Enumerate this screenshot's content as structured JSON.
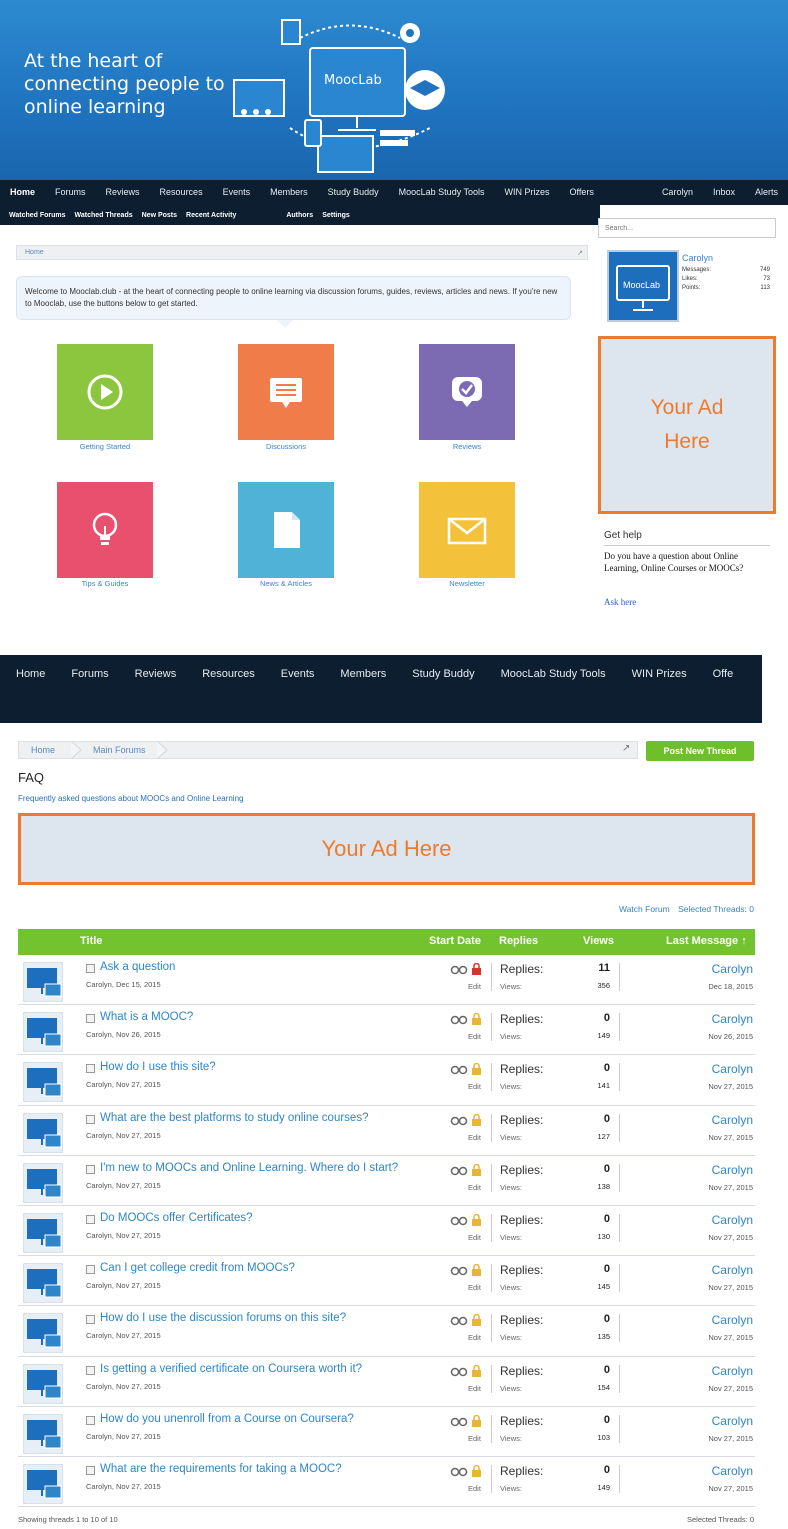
{
  "top": {
    "hero": {
      "tagline": "At the heart of connecting people to online learning",
      "logo_text": "MoocLab"
    },
    "nav": {
      "items": [
        "Home",
        "Forums",
        "Reviews",
        "Resources",
        "Events",
        "Members",
        "Study Buddy",
        "MoocLab Study Tools",
        "WIN Prizes",
        "Offers"
      ],
      "right_items": [
        "Carolyn",
        "Inbox",
        "Alerts"
      ]
    },
    "subnav": {
      "items": [
        "Watched Forums",
        "Watched Threads",
        "New Posts",
        "Recent Activity"
      ],
      "right_items": [
        "Authors",
        "Settings"
      ]
    },
    "breadcrumb": {
      "home": "Home"
    },
    "welcome_text": "Welcome to Mooclab.club - at the heart of connecting people to online learning via discussion forums, guides, reviews, articles and news. If you're new to Mooclab, use the buttons below to get started.",
    "tiles": [
      {
        "label": "Getting Started",
        "color": "#8cc63f",
        "icon": "play-icon"
      },
      {
        "label": "Discussions",
        "color": "#f07c4a",
        "icon": "chat-bubble-icon"
      },
      {
        "label": "Reviews",
        "color": "#7c6ab2",
        "icon": "review-check-icon"
      },
      {
        "label": "Tips & Guides",
        "color": "#e8506e",
        "icon": "lightbulb-icon"
      },
      {
        "label": "News & Articles",
        "color": "#4fb2d6",
        "icon": "document-icon"
      },
      {
        "label": "Newsletter",
        "color": "#f3c23a",
        "icon": "envelope-icon"
      }
    ],
    "sidebar": {
      "search_placeholder": "Search...",
      "profile": {
        "name": "Carolyn",
        "avatar_text": "MoocLab",
        "stats": [
          {
            "label": "Messages:",
            "value": "749"
          },
          {
            "label": "Likes:",
            "value": "73"
          },
          {
            "label": "Points:",
            "value": "113"
          }
        ]
      },
      "ad_line1": "Your Ad",
      "ad_line2": "Here",
      "help": {
        "title": "Get help",
        "body": "Do you have a question about Online Learning, Online Courses or MOOCs?",
        "link": "Ask here"
      }
    }
  },
  "bottom": {
    "nav": {
      "items": [
        "Home",
        "Forums",
        "Reviews",
        "Resources",
        "Events",
        "Members",
        "Study Buddy",
        "MoocLab Study Tools",
        "WIN Prizes",
        "Offe"
      ]
    },
    "breadcrumb": {
      "home": "Home",
      "forums": "Main Forums"
    },
    "post_thread_label": "Post New Thread",
    "forum": {
      "title": "FAQ",
      "description": "Frequently asked questions about MOOCs and Online Learning"
    },
    "ad_banner": "Your Ad Here",
    "toolbar": {
      "watch": "Watch Forum",
      "selected": "Selected Threads: 0"
    },
    "columns": {
      "title": "Title",
      "start_date": "Start Date",
      "replies": "Replies",
      "views": "Views",
      "last_message": "Last Message ↑"
    },
    "threads": [
      {
        "title": "Ask a question",
        "meta": "Carolyn, Dec 15, 2015",
        "replies": "11",
        "views": "356",
        "last_user": "Carolyn",
        "last_date": "Dec 18, 2015",
        "sticky": true
      },
      {
        "title": "What is a MOOC?",
        "meta": "Carolyn, Nov 26, 2015",
        "replies": "0",
        "views": "149",
        "last_user": "Carolyn",
        "last_date": "Nov 26, 2015",
        "sticky": false
      },
      {
        "title": "How do I use this site?",
        "meta": "Carolyn, Nov 27, 2015",
        "replies": "0",
        "views": "141",
        "last_user": "Carolyn",
        "last_date": "Nov 27, 2015",
        "sticky": false
      },
      {
        "title": "What are the best platforms to study online courses?",
        "meta": "Carolyn, Nov 27, 2015",
        "replies": "0",
        "views": "127",
        "last_user": "Carolyn",
        "last_date": "Nov 27, 2015",
        "sticky": false
      },
      {
        "title": "I'm new to MOOCs and Online Learning. Where do I start?",
        "meta": "Carolyn, Nov 27, 2015",
        "replies": "0",
        "views": "138",
        "last_user": "Carolyn",
        "last_date": "Nov 27, 2015",
        "sticky": false
      },
      {
        "title": "Do MOOCs offer Certificates?",
        "meta": "Carolyn, Nov 27, 2015",
        "replies": "0",
        "views": "130",
        "last_user": "Carolyn",
        "last_date": "Nov 27, 2015",
        "sticky": false
      },
      {
        "title": "Can I get college credit from MOOCs?",
        "meta": "Carolyn, Nov 27, 2015",
        "replies": "0",
        "views": "145",
        "last_user": "Carolyn",
        "last_date": "Nov 27, 2015",
        "sticky": false
      },
      {
        "title": "How do I use the discussion forums on this site?",
        "meta": "Carolyn, Nov 27, 2015",
        "replies": "0",
        "views": "135",
        "last_user": "Carolyn",
        "last_date": "Nov 27, 2015",
        "sticky": false
      },
      {
        "title": "Is getting a verified certificate on Coursera worth it?",
        "meta": "Carolyn, Nov 27, 2015",
        "replies": "0",
        "views": "154",
        "last_user": "Carolyn",
        "last_date": "Nov 27, 2015",
        "sticky": false
      },
      {
        "title": "How do you unenroll from a Course on Coursera?",
        "meta": "Carolyn, Nov 27, 2015",
        "replies": "0",
        "views": "103",
        "last_user": "Carolyn",
        "last_date": "Nov 27, 2015",
        "sticky": false
      },
      {
        "title": "What are the requirements for taking a MOOC?",
        "meta": "Carolyn, Nov 27, 2015",
        "replies": "0",
        "views": "149",
        "last_user": "Carolyn",
        "last_date": "Nov 27, 2015",
        "sticky": false
      }
    ],
    "row_labels": {
      "replies": "Replies:",
      "views": "Views:",
      "edit": "Edit"
    },
    "footer": {
      "showing": "Showing threads 1 to 10 of 10",
      "selected": "Selected Threads: 0"
    }
  }
}
